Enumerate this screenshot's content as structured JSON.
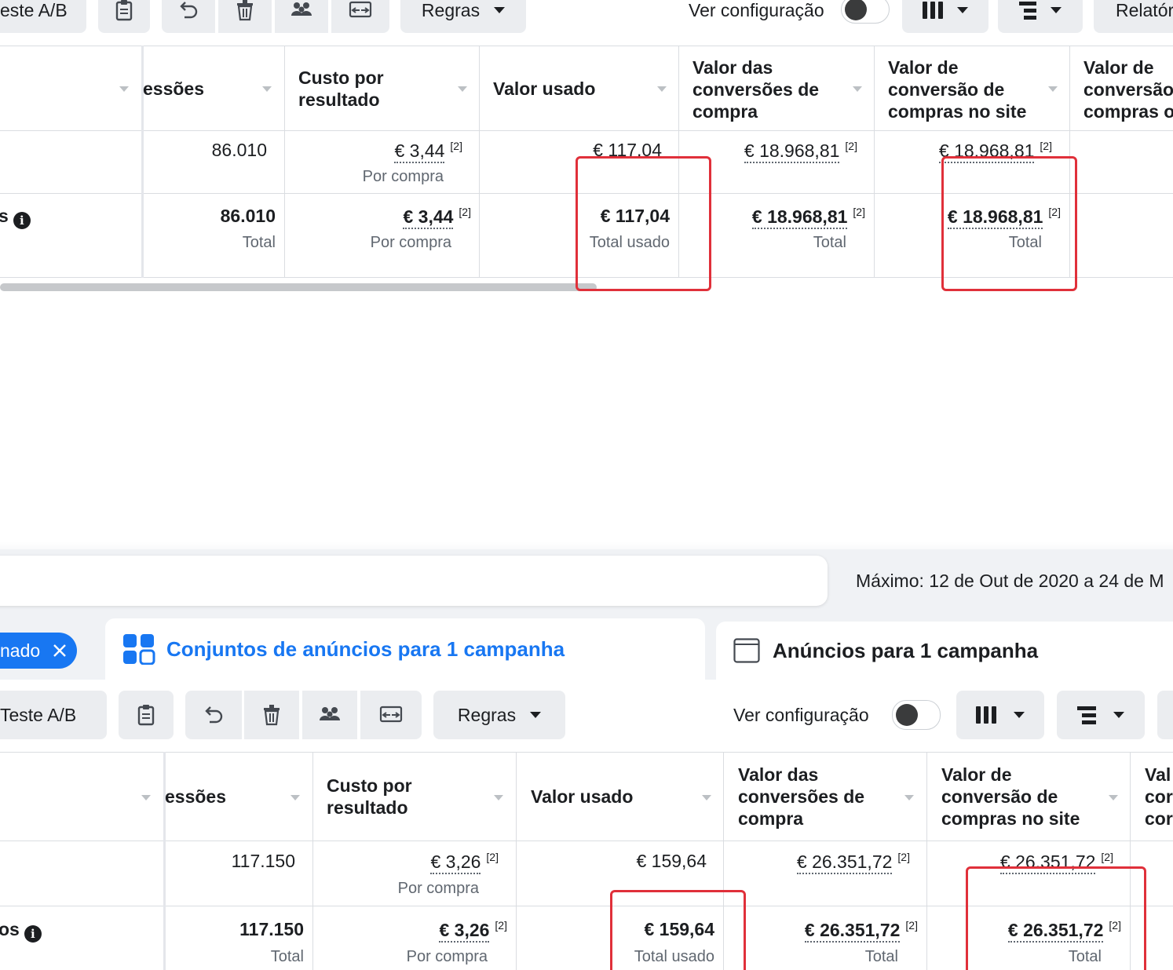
{
  "top": {
    "toolbar": {
      "ab_test_label": "este A/B",
      "rules_label": "Regras",
      "view_config_label": "Ver configuração",
      "reports_label": "Relatór"
    },
    "headers": {
      "impressions": "essões",
      "cost_per_result": [
        "Custo por",
        "resultado"
      ],
      "amount_spent": "Valor usado",
      "purchase_conv_value": [
        "Valor das",
        "conversões de",
        "compra"
      ],
      "website_purchase_value": [
        "Valor de",
        "conversão de",
        "compras no site"
      ],
      "offline_purchase_value": [
        "Valor de",
        "conversão",
        "compras o"
      ]
    },
    "row1": {
      "impressions": "86.010",
      "cost_per_result": "€ 3,44",
      "cost_per_result_note": "[2]",
      "cost_per_result_sub": "Por compra",
      "amount_spent": "€ 117,04",
      "purchase_conv_value": "€ 18.968,81",
      "purchase_conv_note": "[2]",
      "website_purchase_value": "€ 18.968,81",
      "website_purchase_note": "[2]"
    },
    "total": {
      "label_fragment": "s",
      "impressions": "86.010",
      "impressions_sub": "Total",
      "cost_per_result": "€ 3,44",
      "cost_per_result_note": "[2]",
      "cost_per_result_sub": "Por compra",
      "amount_spent": "€ 117,04",
      "amount_spent_sub": "Total usado",
      "purchase_conv_value": "€ 18.968,81",
      "purchase_conv_note": "[2]",
      "purchase_conv_sub": "Total",
      "website_purchase_value": "€ 18.968,81",
      "website_purchase_note": "[2]",
      "website_purchase_sub": "Total"
    }
  },
  "middle": {
    "date_range": "Máximo: 12 de Out de 2020 a 24 de M",
    "filter_chip": "nado",
    "tab_adsets": "Conjuntos de anúncios para 1 campanha",
    "tab_ads": "Anúncios para 1 campanha"
  },
  "bottom": {
    "toolbar": {
      "ab_test_label": "Teste A/B",
      "rules_label": "Regras",
      "view_config_label": "Ver configuração"
    },
    "headers": {
      "impressions": "essões",
      "cost_per_result": [
        "Custo por",
        "resultado"
      ],
      "amount_spent": "Valor usado",
      "purchase_conv_value": [
        "Valor das",
        "conversões de",
        "compra"
      ],
      "website_purchase_value": [
        "Valor de",
        "conversão de",
        "compras no site"
      ],
      "offline_purchase_value": [
        "Val",
        "cor",
        "cor"
      ]
    },
    "row1": {
      "impressions": "117.150",
      "cost_per_result": "€ 3,26",
      "cost_per_result_note": "[2]",
      "cost_per_result_sub": "Por compra",
      "amount_spent": "€ 159,64",
      "purchase_conv_value": "€ 26.351,72",
      "purchase_conv_note": "[2]",
      "website_purchase_value": "€ 26.351,72",
      "website_purchase_note": "[2]"
    },
    "total": {
      "label_fragment": "os",
      "impressions": "117.150",
      "impressions_sub": "Total",
      "cost_per_result": "€ 3,26",
      "cost_per_result_note": "[2]",
      "cost_per_result_sub": "Por compra",
      "amount_spent": "€ 159,64",
      "amount_spent_sub": "Total usado",
      "purchase_conv_value": "€ 26.351,72",
      "purchase_conv_note": "[2]",
      "purchase_conv_sub": "Total",
      "website_purchase_value": "€ 26.351,72",
      "website_purchase_note": "[2]",
      "website_purchase_sub": "Total"
    }
  },
  "colors": {
    "accent": "#1877f2",
    "highlight": "#e0303a",
    "button_bg": "#ebedf0"
  }
}
